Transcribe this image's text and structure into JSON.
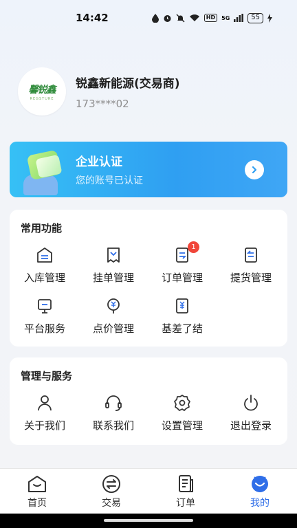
{
  "status_bar": {
    "time": "14:42",
    "hd": "HD",
    "signal_label": "5G",
    "battery": "55"
  },
  "profile": {
    "logo_text": "馨锐鑫",
    "logo_sub": "REGSTURE",
    "company": "锐鑫新能源(交易商)",
    "phone": "173****02"
  },
  "certification": {
    "title": "企业认证",
    "subtitle": "您的账号已认证"
  },
  "common_functions": {
    "title": "常用功能",
    "items": [
      {
        "label": "入库管理",
        "icon": "warehouse-in-icon"
      },
      {
        "label": "挂单管理",
        "icon": "order-listing-icon"
      },
      {
        "label": "订单管理",
        "icon": "order-icon",
        "badge": "1"
      },
      {
        "label": "提货管理",
        "icon": "pickup-icon"
      },
      {
        "label": "平台服务",
        "icon": "platform-service-icon"
      },
      {
        "label": "点价管理",
        "icon": "pricing-icon"
      },
      {
        "label": "基差了结",
        "icon": "basis-settlement-icon"
      }
    ]
  },
  "manage_services": {
    "title": "管理与服务",
    "items": [
      {
        "label": "关于我们",
        "icon": "user-icon"
      },
      {
        "label": "联系我们",
        "icon": "headset-icon"
      },
      {
        "label": "设置管理",
        "icon": "gear-icon"
      },
      {
        "label": "退出登录",
        "icon": "power-icon"
      }
    ]
  },
  "tab_bar": {
    "tabs": [
      {
        "label": "首页",
        "icon": "home-icon"
      },
      {
        "label": "交易",
        "icon": "exchange-icon"
      },
      {
        "label": "订单",
        "icon": "orders-icon"
      },
      {
        "label": "我的",
        "icon": "profile-icon",
        "active": true
      }
    ]
  },
  "colors": {
    "accent": "#2f6ee8",
    "badge": "#f0463a",
    "cert_gradient_start": "#36c0f5",
    "cert_gradient_end": "#2f9ff2"
  }
}
